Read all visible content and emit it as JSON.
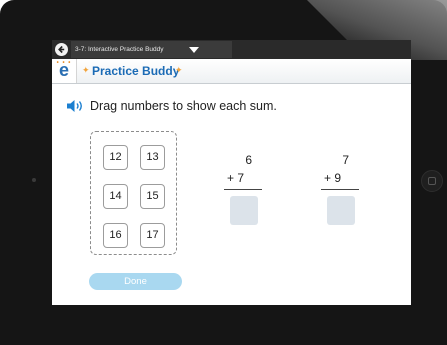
{
  "topbar": {
    "back_icon": "back-arrow-icon",
    "title": "3-7: Interactive Practice Buddy",
    "dropdown_icon": "caret-down-icon"
  },
  "header": {
    "logo_letter": "e",
    "title": "Practice Buddy",
    "star_char": "✦"
  },
  "instruction": {
    "speaker_icon": "speaker-icon",
    "text": "Drag numbers to show each sum."
  },
  "tiles": [
    "12",
    "13",
    "14",
    "15",
    "16",
    "17"
  ],
  "problems": [
    {
      "top": "6",
      "add": "+ 7"
    },
    {
      "top": "7",
      "add": "+ 9"
    }
  ],
  "done_label": "Done",
  "colors": {
    "brand_blue": "#1b6bb5",
    "star_orange": "#f2a33a",
    "done_button": "#a9d8f0",
    "answer_box": "#dce3ea"
  }
}
